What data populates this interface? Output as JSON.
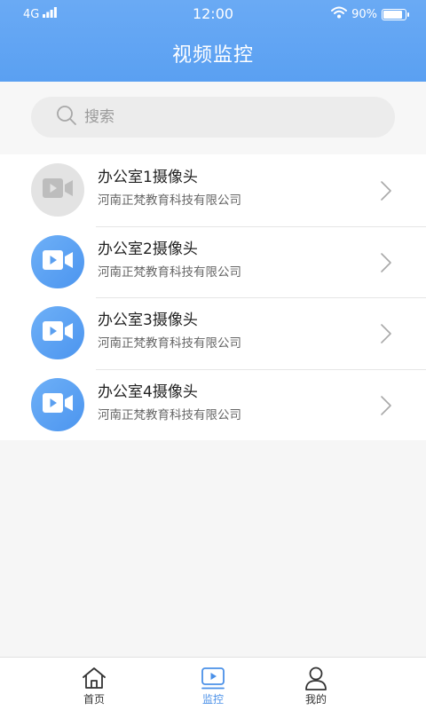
{
  "status_bar": {
    "network": "4G",
    "time": "12:00",
    "battery_text": "90%",
    "battery_level": 0.9
  },
  "header": {
    "title": "视频监控"
  },
  "search": {
    "placeholder": "搜索"
  },
  "cameras": [
    {
      "name": "办公室1摄像头",
      "org": "河南正梵教育科技有限公司",
      "online": false
    },
    {
      "name": "办公室2摄像头",
      "org": "河南正梵教育科技有限公司",
      "online": true
    },
    {
      "name": "办公室3摄像头",
      "org": "河南正梵教育科技有限公司",
      "online": true
    },
    {
      "name": "办公室4摄像头",
      "org": "河南正梵教育科技有限公司",
      "online": true
    }
  ],
  "tabbar": {
    "items": [
      {
        "label": "首页",
        "icon": "home-icon",
        "active": false
      },
      {
        "label": "监控",
        "icon": "video-play-icon",
        "active": true
      },
      {
        "label": "我的",
        "icon": "user-icon",
        "active": false
      }
    ]
  },
  "colors": {
    "header": "#5aa0f2",
    "accent": "#4a90e8",
    "avatar_online": "#5a9ff0",
    "avatar_offline": "#e3e3e3"
  },
  "icons": {
    "search": "search-icon",
    "chevron": "chevron-right-icon",
    "camera": "video-camera-icon",
    "wifi": "wifi-icon",
    "signal": "signal-icon",
    "battery": "battery-icon"
  }
}
